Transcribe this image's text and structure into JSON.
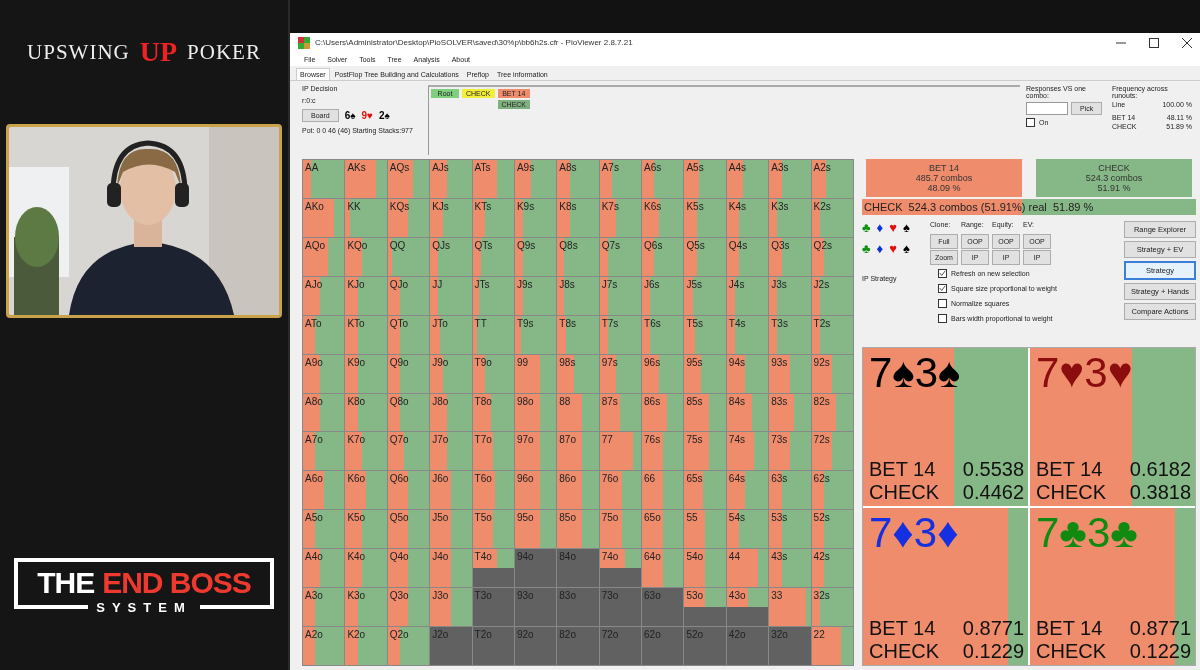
{
  "branding": {
    "top_logo": {
      "left": "UPSWING",
      "monogram": "UP",
      "right": "POKER"
    },
    "bottom_logo": {
      "first": "THE",
      "second": "END BOSS",
      "third": "SYSTEM"
    }
  },
  "window": {
    "title": "C:\\Users\\Administrator\\Desktop\\PioSOLVER\\saved\\30%p\\bb6h2s.cfr - PioViewer 2.8.7.21"
  },
  "menu": [
    "File",
    "Solver",
    "Tools",
    "Tree",
    "Analysis",
    "About"
  ],
  "tabs": [
    {
      "label": "Browser",
      "selected": true
    },
    {
      "label": "PostFlop Tree Building and Calculations",
      "selected": false
    },
    {
      "label": "Preflop",
      "selected": false
    },
    {
      "label": "Tree information",
      "selected": false
    }
  ],
  "info": {
    "decision": "IP Decision",
    "line": "r:0:c",
    "board_button": "Board",
    "board": [
      {
        "card": "6♠",
        "color": "#000000"
      },
      {
        "card": "9♥",
        "color": "#e01010"
      },
      {
        "card": "2♠",
        "color": "#000000"
      }
    ],
    "pot": "Pot: 0 0 46 (46) Starting Stacks:977"
  },
  "tree": [
    {
      "label": "Root",
      "color": "#7fcf7f"
    },
    {
      "label": "CHECK",
      "color": "#f2ee3a"
    },
    {
      "label": "BET 14",
      "color": "#ef8c6c",
      "children": [
        {
          "label": "CHECK",
          "color": "#7fb07f"
        }
      ]
    }
  ],
  "responses": {
    "label": "Responses VS one combo:",
    "pick": "Pick",
    "on": {
      "label": "On",
      "checked": false
    }
  },
  "frequency": {
    "title": "Frequency across runouts:",
    "rows": [
      {
        "name": "Line",
        "value": "100.00 %"
      },
      {
        "name": "BET 14",
        "value": "48.11 %"
      },
      {
        "name": "CHECK",
        "value": "51.89 %"
      }
    ]
  },
  "matrix": [
    {
      "cells": [
        {
          "hand": "AA",
          "kind": "in",
          "level": 0.2
        },
        {
          "hand": "AKs",
          "kind": "in",
          "level": 0.75
        },
        {
          "hand": "AQs",
          "kind": "in",
          "level": 0.6
        },
        {
          "hand": "AJs",
          "kind": "in",
          "level": 0.4
        },
        {
          "hand": "ATs",
          "kind": "in",
          "level": 0.6
        },
        {
          "hand": "A9s",
          "kind": "in",
          "level": 0.4
        },
        {
          "hand": "A8s",
          "kind": "in",
          "level": 0.3
        },
        {
          "hand": "A7s",
          "kind": "in",
          "level": 0.3
        },
        {
          "hand": "A6s",
          "kind": "in",
          "level": 0.3
        },
        {
          "hand": "A5s",
          "kind": "in",
          "level": 0.35
        },
        {
          "hand": "A4s",
          "kind": "in",
          "level": 0.4
        },
        {
          "hand": "A3s",
          "kind": "in",
          "level": 0.3
        },
        {
          "hand": "A2s",
          "kind": "in",
          "level": 0.35
        }
      ]
    },
    {
      "cells": [
        {
          "hand": "AKo",
          "kind": "in",
          "level": 0.75
        },
        {
          "hand": "KK",
          "kind": "in",
          "level": 0.1
        },
        {
          "hand": "KQs",
          "kind": "in",
          "level": 0.5
        },
        {
          "hand": "KJs",
          "kind": "in",
          "level": 0.3
        },
        {
          "hand": "KTs",
          "kind": "in",
          "level": 0.3
        },
        {
          "hand": "K9s",
          "kind": "in",
          "level": 0.2
        },
        {
          "hand": "K8s",
          "kind": "in",
          "level": 0.3
        },
        {
          "hand": "K7s",
          "kind": "in",
          "level": 0.4
        },
        {
          "hand": "K6s",
          "kind": "in",
          "level": 0.4
        },
        {
          "hand": "K5s",
          "kind": "in",
          "level": 0.3
        },
        {
          "hand": "K4s",
          "kind": "in",
          "level": 0.3
        },
        {
          "hand": "K3s",
          "kind": "in",
          "level": 0.2
        },
        {
          "hand": "K2s",
          "kind": "in",
          "level": 0.2
        }
      ]
    },
    {
      "cells": [
        {
          "hand": "AQo",
          "kind": "in",
          "level": 0.6
        },
        {
          "hand": "KQo",
          "kind": "in",
          "level": 0.4
        },
        {
          "hand": "QQ",
          "kind": "in",
          "level": 0.1
        },
        {
          "hand": "QJs",
          "kind": "in",
          "level": 0.2
        },
        {
          "hand": "QTs",
          "kind": "in",
          "level": 0.2
        },
        {
          "hand": "Q9s",
          "kind": "in",
          "level": 0.2
        },
        {
          "hand": "Q8s",
          "kind": "in",
          "level": 0.15
        },
        {
          "hand": "Q7s",
          "kind": "in",
          "level": 0.2
        },
        {
          "hand": "Q6s",
          "kind": "in",
          "level": 0.3
        },
        {
          "hand": "Q5s",
          "kind": "in",
          "level": 0.3
        },
        {
          "hand": "Q4s",
          "kind": "in",
          "level": 0.3
        },
        {
          "hand": "Q3s",
          "kind": "in",
          "level": 0.3
        },
        {
          "hand": "Q2s",
          "kind": "in",
          "level": 0.3
        }
      ]
    },
    {
      "cells": [
        {
          "hand": "AJo",
          "kind": "in",
          "level": 0.4
        },
        {
          "hand": "KJo",
          "kind": "in",
          "level": 0.3
        },
        {
          "hand": "QJo",
          "kind": "in",
          "level": 0.3
        },
        {
          "hand": "JJ",
          "kind": "in",
          "level": 0.2
        },
        {
          "hand": "JTs",
          "kind": "in",
          "level": 0.15
        },
        {
          "hand": "J9s",
          "kind": "in",
          "level": 0.2
        },
        {
          "hand": "J8s",
          "kind": "in",
          "level": 0.15
        },
        {
          "hand": "J7s",
          "kind": "in",
          "level": 0.2
        },
        {
          "hand": "J6s",
          "kind": "in",
          "level": 0.2
        },
        {
          "hand": "J5s",
          "kind": "in",
          "level": 0.2
        },
        {
          "hand": "J4s",
          "kind": "in",
          "level": 0.2
        },
        {
          "hand": "J3s",
          "kind": "in",
          "level": 0.2
        },
        {
          "hand": "J2s",
          "kind": "in",
          "level": 0.2
        }
      ]
    },
    {
      "cells": [
        {
          "hand": "ATo",
          "kind": "in",
          "level": 0.3
        },
        {
          "hand": "KTo",
          "kind": "in",
          "level": 0.3
        },
        {
          "hand": "QTo",
          "kind": "in",
          "level": 0.3
        },
        {
          "hand": "JTo",
          "kind": "in",
          "level": 0.25
        },
        {
          "hand": "TT",
          "kind": "in",
          "level": 0.1
        },
        {
          "hand": "T9s",
          "kind": "in",
          "level": 0.15
        },
        {
          "hand": "T8s",
          "kind": "in",
          "level": 0.2
        },
        {
          "hand": "T7s",
          "kind": "in",
          "level": 0.2
        },
        {
          "hand": "T6s",
          "kind": "in",
          "level": 0.2
        },
        {
          "hand": "T5s",
          "kind": "in",
          "level": 0.25
        },
        {
          "hand": "T4s",
          "kind": "in",
          "level": 0.2
        },
        {
          "hand": "T3s",
          "kind": "in",
          "level": 0.2
        },
        {
          "hand": "T2s",
          "kind": "in",
          "level": 0.2
        }
      ]
    },
    {
      "cells": [
        {
          "hand": "A9o",
          "kind": "in",
          "level": 0.4
        },
        {
          "hand": "K9o",
          "kind": "in",
          "level": 0.3
        },
        {
          "hand": "Q9o",
          "kind": "in",
          "level": 0.3
        },
        {
          "hand": "J9o",
          "kind": "in",
          "level": 0.3
        },
        {
          "hand": "T9o",
          "kind": "in",
          "level": 0.3
        },
        {
          "hand": "99",
          "kind": "in",
          "level": 0.6
        },
        {
          "hand": "98s",
          "kind": "in",
          "level": 0.4
        },
        {
          "hand": "97s",
          "kind": "in",
          "level": 0.4
        },
        {
          "hand": "96s",
          "kind": "in",
          "level": 0.4
        },
        {
          "hand": "95s",
          "kind": "in",
          "level": 0.4
        },
        {
          "hand": "94s",
          "kind": "in",
          "level": 0.45
        },
        {
          "hand": "93s",
          "kind": "in",
          "level": 0.5
        },
        {
          "hand": "92s",
          "kind": "in",
          "level": 0.5
        }
      ]
    },
    {
      "cells": [
        {
          "hand": "A8o",
          "kind": "in",
          "level": 0.4
        },
        {
          "hand": "K8o",
          "kind": "in",
          "level": 0.3
        },
        {
          "hand": "Q8o",
          "kind": "in",
          "level": 0.3
        },
        {
          "hand": "J8o",
          "kind": "in",
          "level": 0.4
        },
        {
          "hand": "T8o",
          "kind": "in",
          "level": 0.45
        },
        {
          "hand": "98o",
          "kind": "in",
          "level": 0.6
        },
        {
          "hand": "88",
          "kind": "in",
          "level": 0.6
        },
        {
          "hand": "87s",
          "kind": "in",
          "level": 0.5
        },
        {
          "hand": "86s",
          "kind": "in",
          "level": 0.6
        },
        {
          "hand": "85s",
          "kind": "in",
          "level": 0.6
        },
        {
          "hand": "84s",
          "kind": "in",
          "level": 0.6
        },
        {
          "hand": "83s",
          "kind": "in",
          "level": 0.6
        },
        {
          "hand": "82s",
          "kind": "in",
          "level": 0.6
        }
      ]
    },
    {
      "cells": [
        {
          "hand": "A7o",
          "kind": "in",
          "level": 0.3
        },
        {
          "hand": "K7o",
          "kind": "in",
          "level": 0.4
        },
        {
          "hand": "Q7o",
          "kind": "in",
          "level": 0.4
        },
        {
          "hand": "J7o",
          "kind": "in",
          "level": 0.4
        },
        {
          "hand": "T7o",
          "kind": "in",
          "level": 0.5
        },
        {
          "hand": "97o",
          "kind": "in",
          "level": 0.6
        },
        {
          "hand": "87o",
          "kind": "in",
          "level": 0.6
        },
        {
          "hand": "77",
          "kind": "in",
          "level": 0.8
        },
        {
          "hand": "76s",
          "kind": "in",
          "level": 0.5
        },
        {
          "hand": "75s",
          "kind": "in",
          "level": 0.6
        },
        {
          "hand": "74s",
          "kind": "in",
          "level": 0.65
        },
        {
          "hand": "73s",
          "kind": "in",
          "level": 0.5
        },
        {
          "hand": "72s",
          "kind": "in",
          "level": 0.5
        }
      ]
    },
    {
      "cells": [
        {
          "hand": "A6o",
          "kind": "in",
          "level": 0.5
        },
        {
          "hand": "K6o",
          "kind": "in",
          "level": 0.5
        },
        {
          "hand": "Q6o",
          "kind": "in",
          "level": 0.5
        },
        {
          "hand": "J6o",
          "kind": "in",
          "level": 0.5
        },
        {
          "hand": "T6o",
          "kind": "in",
          "level": 0.55
        },
        {
          "hand": "96o",
          "kind": "in",
          "level": 0.6
        },
        {
          "hand": "86o",
          "kind": "in",
          "level": 0.6
        },
        {
          "hand": "76o",
          "kind": "in",
          "level": 0.55
        },
        {
          "hand": "66",
          "kind": "in",
          "level": 0.5
        },
        {
          "hand": "65s",
          "kind": "in",
          "level": 0.45
        },
        {
          "hand": "64s",
          "kind": "in",
          "level": 0.45
        },
        {
          "hand": "63s",
          "kind": "in",
          "level": 0.3
        },
        {
          "hand": "62s",
          "kind": "in",
          "level": 0.3
        }
      ]
    },
    {
      "cells": [
        {
          "hand": "A5o",
          "kind": "in",
          "level": 0.3
        },
        {
          "hand": "K5o",
          "kind": "in",
          "level": 0.4
        },
        {
          "hand": "Q5o",
          "kind": "in",
          "level": 0.5
        },
        {
          "hand": "J5o",
          "kind": "in",
          "level": 0.5
        },
        {
          "hand": "T5o",
          "kind": "in",
          "level": 0.5
        },
        {
          "hand": "95o",
          "kind": "in",
          "level": 0.6
        },
        {
          "hand": "85o",
          "kind": "in",
          "level": 0.6
        },
        {
          "hand": "75o",
          "kind": "in",
          "level": 0.55
        },
        {
          "hand": "65o",
          "kind": "in",
          "level": 0.5
        },
        {
          "hand": "55",
          "kind": "in",
          "level": 0.5
        },
        {
          "hand": "54s",
          "kind": "in",
          "level": 0.3
        },
        {
          "hand": "53s",
          "kind": "in",
          "level": 0.3
        },
        {
          "hand": "52s",
          "kind": "in",
          "level": 0.3
        }
      ]
    },
    {
      "cells": [
        {
          "hand": "A4o",
          "kind": "in",
          "level": 0.4
        },
        {
          "hand": "K4o",
          "kind": "in",
          "level": 0.4
        },
        {
          "hand": "Q4o",
          "kind": "in",
          "level": 0.5
        },
        {
          "hand": "J4o",
          "kind": "in",
          "level": 0.5
        },
        {
          "hand": "T4o",
          "kind": "partial",
          "level": 0.6
        },
        {
          "hand": "94o",
          "kind": "out"
        },
        {
          "hand": "84o",
          "kind": "out"
        },
        {
          "hand": "74o",
          "kind": "partial",
          "level": 0.6
        },
        {
          "hand": "64o",
          "kind": "in",
          "level": 0.5
        },
        {
          "hand": "54o",
          "kind": "in",
          "level": 0.5
        },
        {
          "hand": "44",
          "kind": "in",
          "level": 0.75
        },
        {
          "hand": "43s",
          "kind": "in",
          "level": 0.3
        },
        {
          "hand": "42s",
          "kind": "in",
          "level": 0.3
        }
      ]
    },
    {
      "cells": [
        {
          "hand": "A3o",
          "kind": "in",
          "level": 0.3
        },
        {
          "hand": "K3o",
          "kind": "in",
          "level": 0.3
        },
        {
          "hand": "Q3o",
          "kind": "in",
          "level": 0.5
        },
        {
          "hand": "J3o",
          "kind": "in",
          "level": 0.5
        },
        {
          "hand": "T3o",
          "kind": "out"
        },
        {
          "hand": "93o",
          "kind": "out"
        },
        {
          "hand": "83o",
          "kind": "out"
        },
        {
          "hand": "73o",
          "kind": "out"
        },
        {
          "hand": "63o",
          "kind": "out"
        },
        {
          "hand": "53o",
          "kind": "partial",
          "level": 0.5
        },
        {
          "hand": "43o",
          "kind": "partial",
          "level": 0.5
        },
        {
          "hand": "33",
          "kind": "in",
          "level": 0.9
        },
        {
          "hand": "32s",
          "kind": "in",
          "level": 0.2
        }
      ]
    },
    {
      "cells": [
        {
          "hand": "A2o",
          "kind": "in",
          "level": 0.3
        },
        {
          "hand": "K2o",
          "kind": "in",
          "level": 0.3
        },
        {
          "hand": "Q2o",
          "kind": "in",
          "level": 0.3
        },
        {
          "hand": "J2o",
          "kind": "out"
        },
        {
          "hand": "T2o",
          "kind": "out"
        },
        {
          "hand": "92o",
          "kind": "out"
        },
        {
          "hand": "82o",
          "kind": "out"
        },
        {
          "hand": "72o",
          "kind": "out"
        },
        {
          "hand": "62o",
          "kind": "out"
        },
        {
          "hand": "52o",
          "kind": "out"
        },
        {
          "hand": "42o",
          "kind": "out"
        },
        {
          "hand": "32o",
          "kind": "out"
        },
        {
          "hand": "22",
          "kind": "in",
          "level": 0.7
        }
      ]
    }
  ],
  "summary": [
    {
      "action": "BET 14",
      "combos": "485.7 combos",
      "percent": "48.09 %",
      "color": "#ef8c6c"
    },
    {
      "action": "CHECK",
      "combos": "524.3 combos",
      "percent": "51.91 %",
      "color": "#85b886"
    }
  ],
  "selected_bar": {
    "text": "CHECK  524.3 combos (51.91%) real  51.89 %",
    "level": 0.48
  },
  "suit_rows": [
    [
      {
        "suit": "♣",
        "color": "#109010"
      },
      {
        "suit": "♦",
        "color": "#1030e0"
      },
      {
        "suit": "♥",
        "color": "#e01010"
      },
      {
        "suit": "♠",
        "color": "#000000"
      }
    ],
    [
      {
        "suit": "♣",
        "color": "#109010"
      },
      {
        "suit": "♦",
        "color": "#1030e0"
      },
      {
        "suit": "♥",
        "color": "#e01010"
      },
      {
        "suit": "♠",
        "color": "#000000"
      }
    ]
  ],
  "view_columns": [
    {
      "title": "Clone:",
      "buttons": [
        "Full",
        "Zoom"
      ]
    },
    {
      "title": "Range:",
      "buttons": [
        "OOP",
        "IP"
      ]
    },
    {
      "title": "Equity:",
      "buttons": [
        "OOP",
        "IP"
      ]
    },
    {
      "title": "EV:",
      "buttons": [
        "OOP",
        "IP"
      ]
    }
  ],
  "strategy_label": "IP Strategy",
  "options": [
    {
      "label": "Refresh on new selection",
      "checked": true
    },
    {
      "label": "Square size proportional to weight",
      "checked": true
    },
    {
      "label": "Normalize squares",
      "checked": false
    },
    {
      "label": "Bars width proportional to weight",
      "checked": false
    }
  ],
  "mode_buttons": [
    {
      "label": "Range Explorer",
      "selected": false
    },
    {
      "label": "Strategy + EV",
      "selected": false
    },
    {
      "label": "Strategy",
      "selected": true
    },
    {
      "label": "Strategy + Hands",
      "selected": false
    },
    {
      "label": "Compare Actions",
      "selected": false
    }
  ],
  "combos": [
    {
      "rank1": "7",
      "rank2": "3",
      "suit": "♠",
      "color": "#000000",
      "level": 0.5538,
      "bet_label": "BET 14",
      "bet": "0.5538",
      "check_label": "CHECK",
      "check": "0.4462"
    },
    {
      "rank1": "7",
      "rank2": "3",
      "suit": "♥",
      "color": "#8b0d0d",
      "level": 0.6182,
      "bet_label": "BET 14",
      "bet": "0.6182",
      "check_label": "CHECK",
      "check": "0.3818"
    },
    {
      "rank1": "7",
      "rank2": "3",
      "suit": "♦",
      "color": "#1530e0",
      "level": 0.8771,
      "bet_label": "BET 14",
      "bet": "0.8771",
      "check_label": "CHECK",
      "check": "0.1229"
    },
    {
      "rank1": "7",
      "rank2": "3",
      "suit": "♣",
      "color": "#108a10",
      "level": 0.8771,
      "bet_label": "BET 14",
      "bet": "0.8771",
      "check_label": "CHECK",
      "check": "0.1229"
    }
  ]
}
